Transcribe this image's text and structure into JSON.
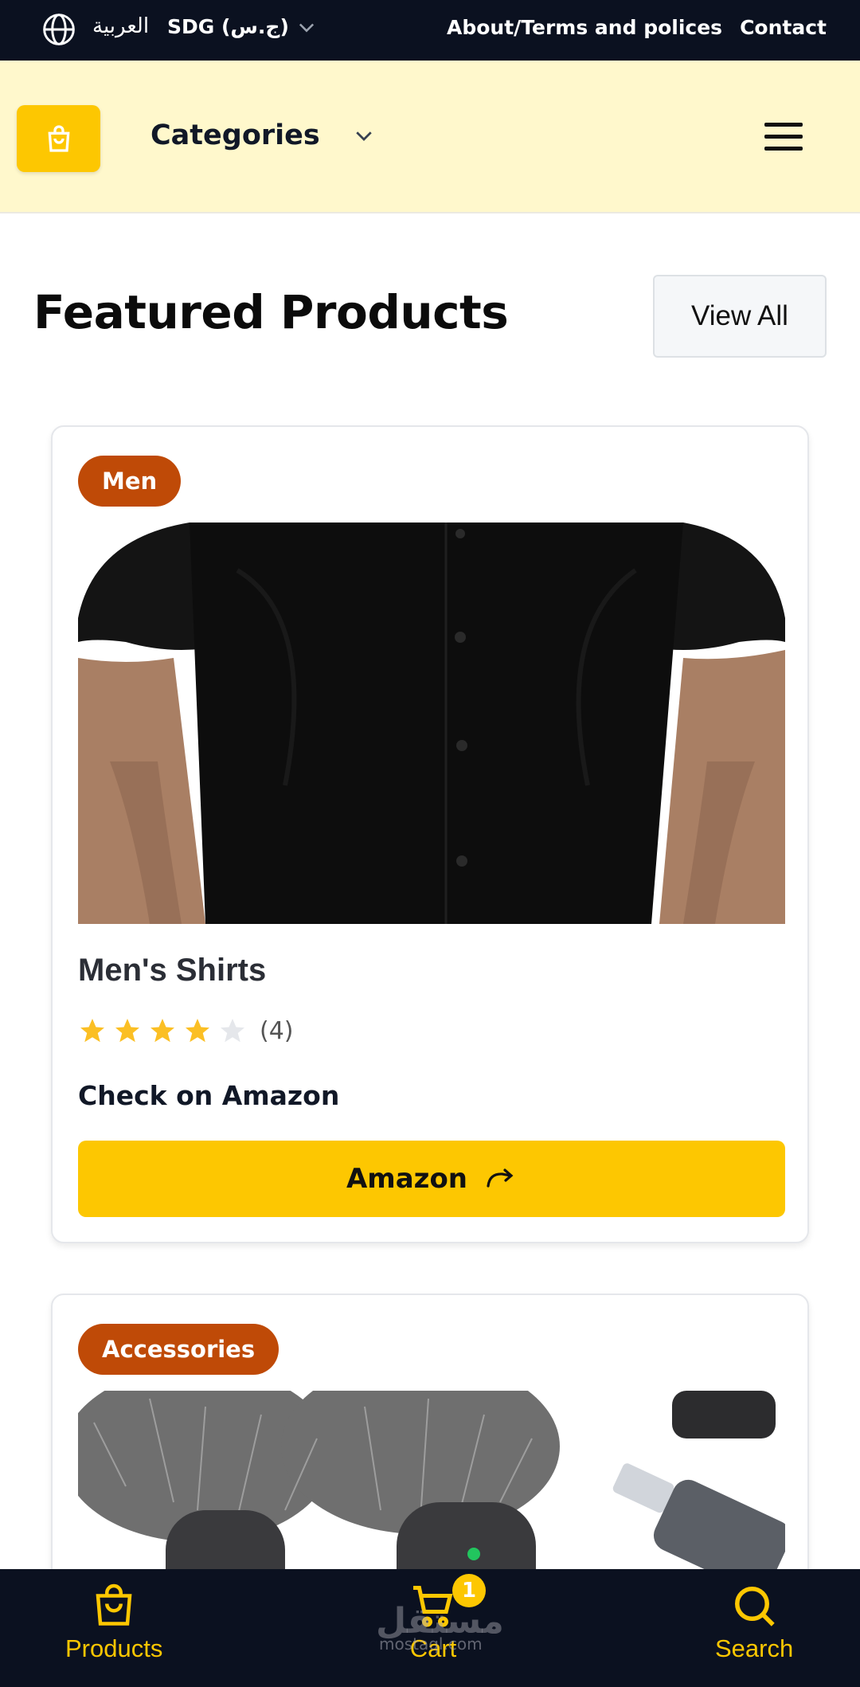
{
  "topbar": {
    "language": "العربية",
    "currency": "SDG (ج.س)",
    "links": [
      "About/Terms and polices",
      "Contact"
    ]
  },
  "header": {
    "categories_label": "Categories"
  },
  "featured": {
    "title": "Featured Products",
    "view_all_label": "View All"
  },
  "products": [
    {
      "badge": "Men",
      "name": "Men's Shirts",
      "rating": 4,
      "max_rating": 5,
      "rating_count": "(4)",
      "check_text": "Check on Amazon",
      "button_label": "Amazon"
    },
    {
      "badge": "Accessories"
    }
  ],
  "bottom_nav": {
    "items": [
      {
        "label": "Products",
        "icon": "shopping-bag-icon"
      },
      {
        "label": "Cart",
        "icon": "cart-icon"
      },
      {
        "label": "Search",
        "icon": "search-icon"
      }
    ],
    "cart_count": "1"
  },
  "watermark": {
    "text": "مستقل",
    "sub": "mostaql.com"
  },
  "colors": {
    "accent": "#fdc701",
    "badge": "#bf4a07",
    "dark": "#0b1120",
    "header_bg": "#fff8cc"
  }
}
